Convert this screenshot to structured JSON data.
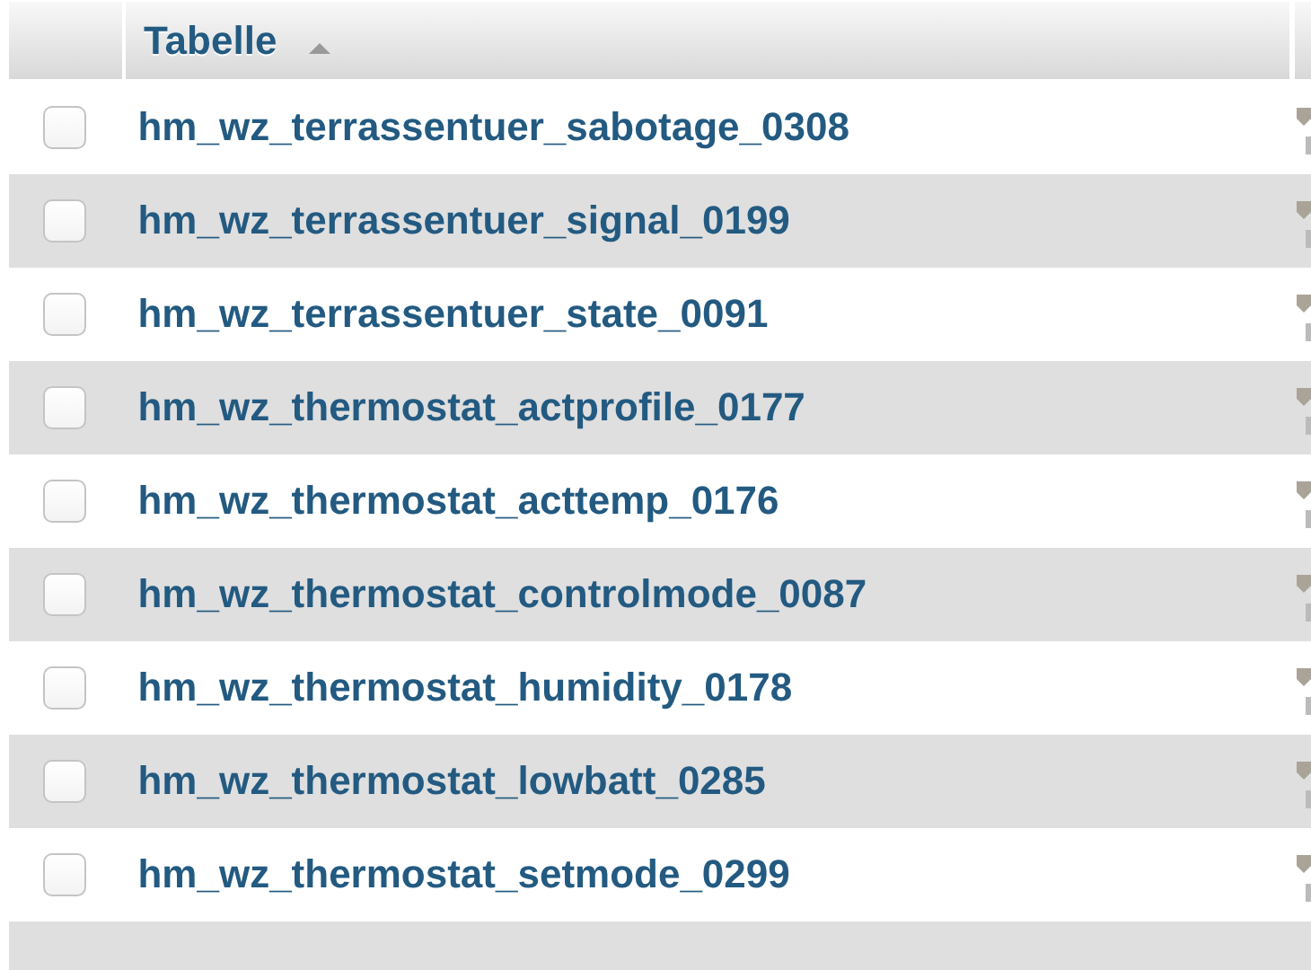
{
  "table": {
    "columns": [
      {
        "label": "Tabelle",
        "sort_ascending": true
      }
    ],
    "rows": [
      {
        "name": "hm_wz_terrassentuer_sabotage_0308",
        "checked": false
      },
      {
        "name": "hm_wz_terrassentuer_signal_0199",
        "checked": false
      },
      {
        "name": "hm_wz_terrassentuer_state_0091",
        "checked": false
      },
      {
        "name": "hm_wz_thermostat_actprofile_0177",
        "checked": false
      },
      {
        "name": "hm_wz_thermostat_acttemp_0176",
        "checked": false
      },
      {
        "name": "hm_wz_thermostat_controlmode_0087",
        "checked": false
      },
      {
        "name": "hm_wz_thermostat_humidity_0178",
        "checked": false
      },
      {
        "name": "hm_wz_thermostat_lowbatt_0285",
        "checked": false
      },
      {
        "name": "hm_wz_thermostat_setmode_0299",
        "checked": false
      }
    ]
  }
}
